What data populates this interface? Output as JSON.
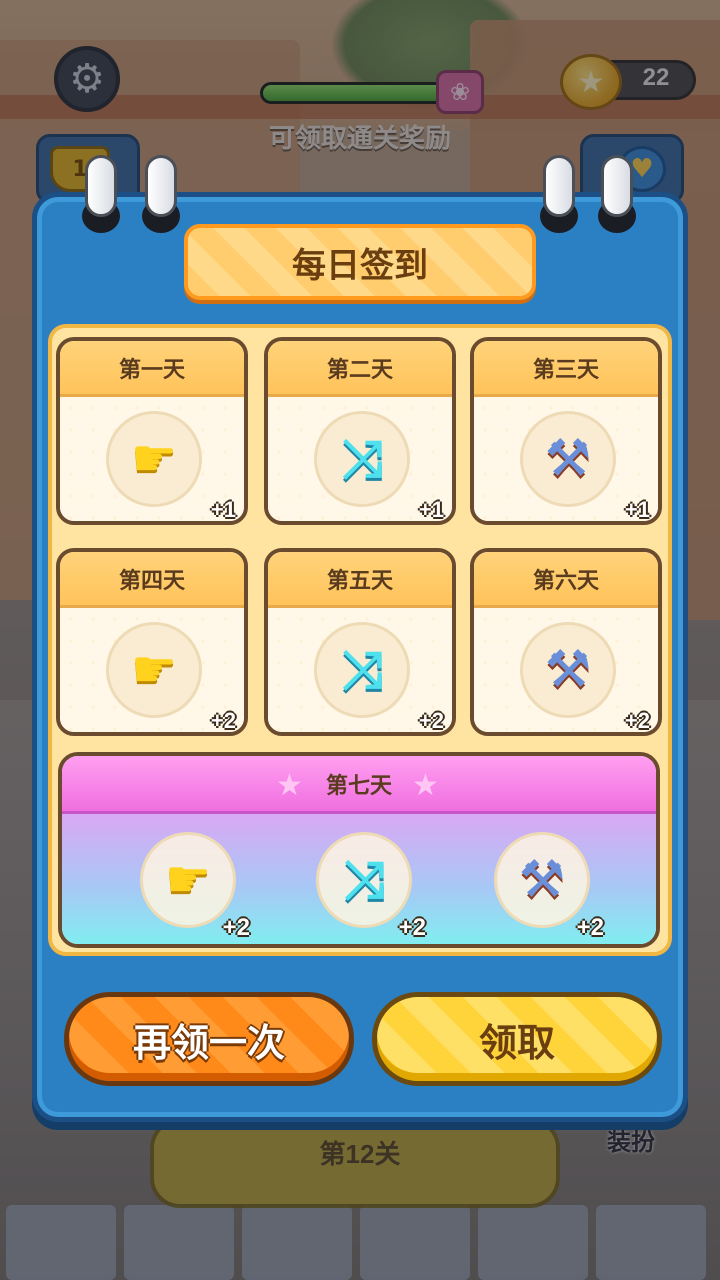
{
  "hud": {
    "settings_icon": "gear-icon",
    "level_progress": 0.85,
    "reward_hint": "可领取通关奖励",
    "coins": "22",
    "trophy_badge": "1",
    "level_label": "第12关",
    "dressup_label": "装扮"
  },
  "dialog": {
    "title": "每日签到",
    "days": [
      {
        "label": "第一天",
        "item": "pointer-hand-icon",
        "glyph": "☛",
        "style": "hand",
        "qty": "+1"
      },
      {
        "label": "第二天",
        "item": "shuffle-icon",
        "glyph": "⤨",
        "style": "shuffle",
        "qty": "+1"
      },
      {
        "label": "第三天",
        "item": "hammer-icon",
        "glyph": "⚒",
        "style": "hammer",
        "qty": "+1"
      },
      {
        "label": "第四天",
        "item": "pointer-hand-icon",
        "glyph": "☛",
        "style": "hand",
        "qty": "+2"
      },
      {
        "label": "第五天",
        "item": "shuffle-icon",
        "glyph": "⤨",
        "style": "shuffle",
        "qty": "+2"
      },
      {
        "label": "第六天",
        "item": "hammer-icon",
        "glyph": "⚒",
        "style": "hammer",
        "qty": "+2"
      }
    ],
    "day7": {
      "label": "第七天",
      "items": [
        {
          "item": "pointer-hand-icon",
          "glyph": "☛",
          "style": "hand",
          "qty": "+2"
        },
        {
          "item": "shuffle-icon",
          "glyph": "⤨",
          "style": "shuffle",
          "qty": "+2"
        },
        {
          "item": "hammer-icon",
          "glyph": "⚒",
          "style": "hammer",
          "qty": "+2"
        }
      ]
    },
    "buttons": {
      "claim_again": "再领一次",
      "claim": "领取"
    }
  },
  "colors": {
    "panel_blue": "#2b80c4",
    "banner_orange": "#ffcc6e",
    "day7_pink": "#f06fe0",
    "button_orange": "#ff8a1a",
    "button_yellow": "#ffd43a"
  }
}
